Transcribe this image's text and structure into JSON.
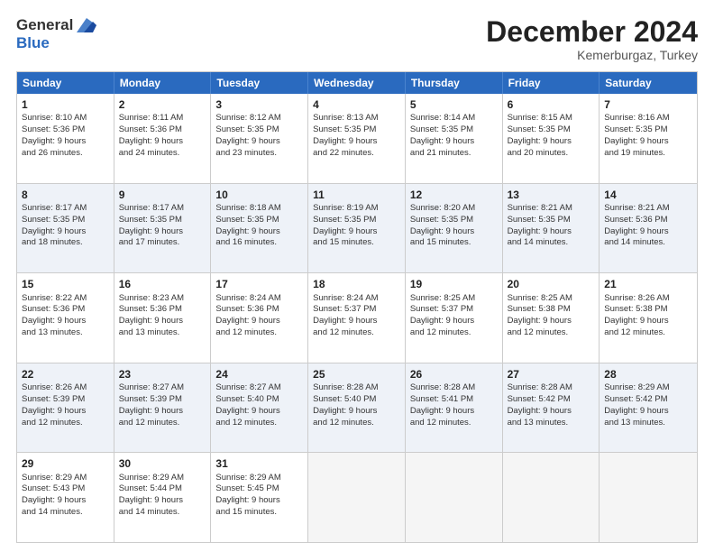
{
  "header": {
    "logo_general": "General",
    "logo_blue": "Blue",
    "month_title": "December 2024",
    "location": "Kemerburgaz, Turkey"
  },
  "days_of_week": [
    "Sunday",
    "Monday",
    "Tuesday",
    "Wednesday",
    "Thursday",
    "Friday",
    "Saturday"
  ],
  "rows": [
    [
      {
        "day": "1",
        "lines": [
          "Sunrise: 8:10 AM",
          "Sunset: 5:36 PM",
          "Daylight: 9 hours",
          "and 26 minutes."
        ]
      },
      {
        "day": "2",
        "lines": [
          "Sunrise: 8:11 AM",
          "Sunset: 5:36 PM",
          "Daylight: 9 hours",
          "and 24 minutes."
        ]
      },
      {
        "day": "3",
        "lines": [
          "Sunrise: 8:12 AM",
          "Sunset: 5:35 PM",
          "Daylight: 9 hours",
          "and 23 minutes."
        ]
      },
      {
        "day": "4",
        "lines": [
          "Sunrise: 8:13 AM",
          "Sunset: 5:35 PM",
          "Daylight: 9 hours",
          "and 22 minutes."
        ]
      },
      {
        "day": "5",
        "lines": [
          "Sunrise: 8:14 AM",
          "Sunset: 5:35 PM",
          "Daylight: 9 hours",
          "and 21 minutes."
        ]
      },
      {
        "day": "6",
        "lines": [
          "Sunrise: 8:15 AM",
          "Sunset: 5:35 PM",
          "Daylight: 9 hours",
          "and 20 minutes."
        ]
      },
      {
        "day": "7",
        "lines": [
          "Sunrise: 8:16 AM",
          "Sunset: 5:35 PM",
          "Daylight: 9 hours",
          "and 19 minutes."
        ]
      }
    ],
    [
      {
        "day": "8",
        "lines": [
          "Sunrise: 8:17 AM",
          "Sunset: 5:35 PM",
          "Daylight: 9 hours",
          "and 18 minutes."
        ]
      },
      {
        "day": "9",
        "lines": [
          "Sunrise: 8:17 AM",
          "Sunset: 5:35 PM",
          "Daylight: 9 hours",
          "and 17 minutes."
        ]
      },
      {
        "day": "10",
        "lines": [
          "Sunrise: 8:18 AM",
          "Sunset: 5:35 PM",
          "Daylight: 9 hours",
          "and 16 minutes."
        ]
      },
      {
        "day": "11",
        "lines": [
          "Sunrise: 8:19 AM",
          "Sunset: 5:35 PM",
          "Daylight: 9 hours",
          "and 15 minutes."
        ]
      },
      {
        "day": "12",
        "lines": [
          "Sunrise: 8:20 AM",
          "Sunset: 5:35 PM",
          "Daylight: 9 hours",
          "and 15 minutes."
        ]
      },
      {
        "day": "13",
        "lines": [
          "Sunrise: 8:21 AM",
          "Sunset: 5:35 PM",
          "Daylight: 9 hours",
          "and 14 minutes."
        ]
      },
      {
        "day": "14",
        "lines": [
          "Sunrise: 8:21 AM",
          "Sunset: 5:36 PM",
          "Daylight: 9 hours",
          "and 14 minutes."
        ]
      }
    ],
    [
      {
        "day": "15",
        "lines": [
          "Sunrise: 8:22 AM",
          "Sunset: 5:36 PM",
          "Daylight: 9 hours",
          "and 13 minutes."
        ]
      },
      {
        "day": "16",
        "lines": [
          "Sunrise: 8:23 AM",
          "Sunset: 5:36 PM",
          "Daylight: 9 hours",
          "and 13 minutes."
        ]
      },
      {
        "day": "17",
        "lines": [
          "Sunrise: 8:24 AM",
          "Sunset: 5:36 PM",
          "Daylight: 9 hours",
          "and 12 minutes."
        ]
      },
      {
        "day": "18",
        "lines": [
          "Sunrise: 8:24 AM",
          "Sunset: 5:37 PM",
          "Daylight: 9 hours",
          "and 12 minutes."
        ]
      },
      {
        "day": "19",
        "lines": [
          "Sunrise: 8:25 AM",
          "Sunset: 5:37 PM",
          "Daylight: 9 hours",
          "and 12 minutes."
        ]
      },
      {
        "day": "20",
        "lines": [
          "Sunrise: 8:25 AM",
          "Sunset: 5:38 PM",
          "Daylight: 9 hours",
          "and 12 minutes."
        ]
      },
      {
        "day": "21",
        "lines": [
          "Sunrise: 8:26 AM",
          "Sunset: 5:38 PM",
          "Daylight: 9 hours",
          "and 12 minutes."
        ]
      }
    ],
    [
      {
        "day": "22",
        "lines": [
          "Sunrise: 8:26 AM",
          "Sunset: 5:39 PM",
          "Daylight: 9 hours",
          "and 12 minutes."
        ]
      },
      {
        "day": "23",
        "lines": [
          "Sunrise: 8:27 AM",
          "Sunset: 5:39 PM",
          "Daylight: 9 hours",
          "and 12 minutes."
        ]
      },
      {
        "day": "24",
        "lines": [
          "Sunrise: 8:27 AM",
          "Sunset: 5:40 PM",
          "Daylight: 9 hours",
          "and 12 minutes."
        ]
      },
      {
        "day": "25",
        "lines": [
          "Sunrise: 8:28 AM",
          "Sunset: 5:40 PM",
          "Daylight: 9 hours",
          "and 12 minutes."
        ]
      },
      {
        "day": "26",
        "lines": [
          "Sunrise: 8:28 AM",
          "Sunset: 5:41 PM",
          "Daylight: 9 hours",
          "and 12 minutes."
        ]
      },
      {
        "day": "27",
        "lines": [
          "Sunrise: 8:28 AM",
          "Sunset: 5:42 PM",
          "Daylight: 9 hours",
          "and 13 minutes."
        ]
      },
      {
        "day": "28",
        "lines": [
          "Sunrise: 8:29 AM",
          "Sunset: 5:42 PM",
          "Daylight: 9 hours",
          "and 13 minutes."
        ]
      }
    ],
    [
      {
        "day": "29",
        "lines": [
          "Sunrise: 8:29 AM",
          "Sunset: 5:43 PM",
          "Daylight: 9 hours",
          "and 14 minutes."
        ]
      },
      {
        "day": "30",
        "lines": [
          "Sunrise: 8:29 AM",
          "Sunset: 5:44 PM",
          "Daylight: 9 hours",
          "and 14 minutes."
        ]
      },
      {
        "day": "31",
        "lines": [
          "Sunrise: 8:29 AM",
          "Sunset: 5:45 PM",
          "Daylight: 9 hours",
          "and 15 minutes."
        ]
      },
      null,
      null,
      null,
      null
    ]
  ]
}
